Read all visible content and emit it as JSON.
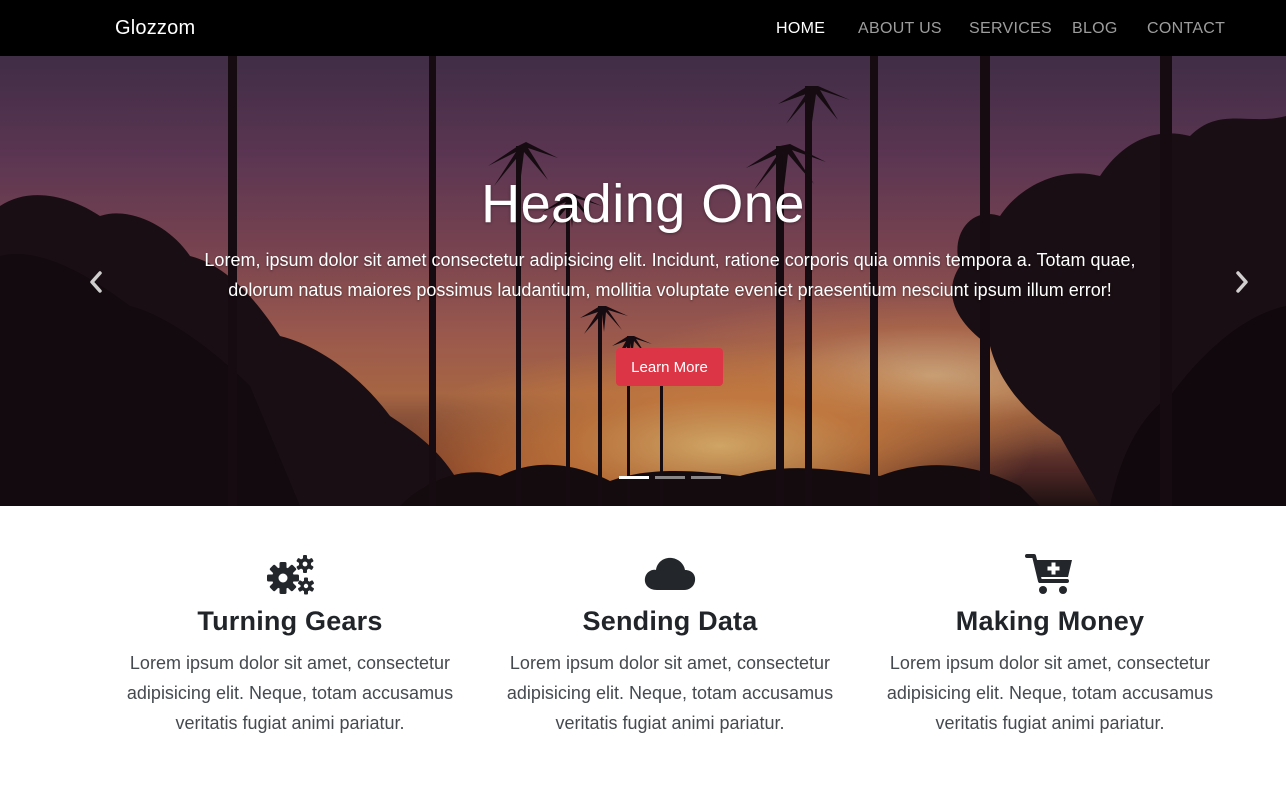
{
  "navbar": {
    "brand": "Glozzom",
    "links": [
      {
        "label": "HOME",
        "active": true
      },
      {
        "label": "ABOUT US",
        "active": false
      },
      {
        "label": "SERVICES",
        "active": false
      },
      {
        "label": "BLOG",
        "active": false
      },
      {
        "label": "CONTACT",
        "active": false
      }
    ]
  },
  "hero": {
    "title": "Heading One",
    "text": "Lorem, ipsum dolor sit amet consectetur adipisicing elit. Incidunt, ratione corporis quia omnis tempora a. Totam quae, dolorum natus maiores possimus laudantium, mollitia voluptate eveniet praesentium nesciunt ipsum illum error!",
    "button_label": "Learn More",
    "prev_icon": "chevron-left-icon",
    "next_icon": "chevron-right-icon",
    "slide_count": 3,
    "active_slide": 1
  },
  "features": [
    {
      "icon": "gears-icon",
      "title": "Turning Gears",
      "text": "Lorem ipsum dolor sit amet, consectetur adipisicing elit. Neque, totam accusamus veritatis fugiat animi pariatur."
    },
    {
      "icon": "cloud-icon",
      "title": "Sending Data",
      "text": "Lorem ipsum dolor sit amet, consectetur adipisicing elit. Neque, totam accusamus veritatis fugiat animi pariatur."
    },
    {
      "icon": "cart-plus-icon",
      "title": "Making Money",
      "text": "Lorem ipsum dolor sit amet, consectetur adipisicing elit. Neque, totam accusamus veritatis fugiat animi pariatur."
    }
  ],
  "colors": {
    "navbar_bg": "#000000",
    "accent_button": "#dc3545",
    "icon_color": "#23272b"
  }
}
